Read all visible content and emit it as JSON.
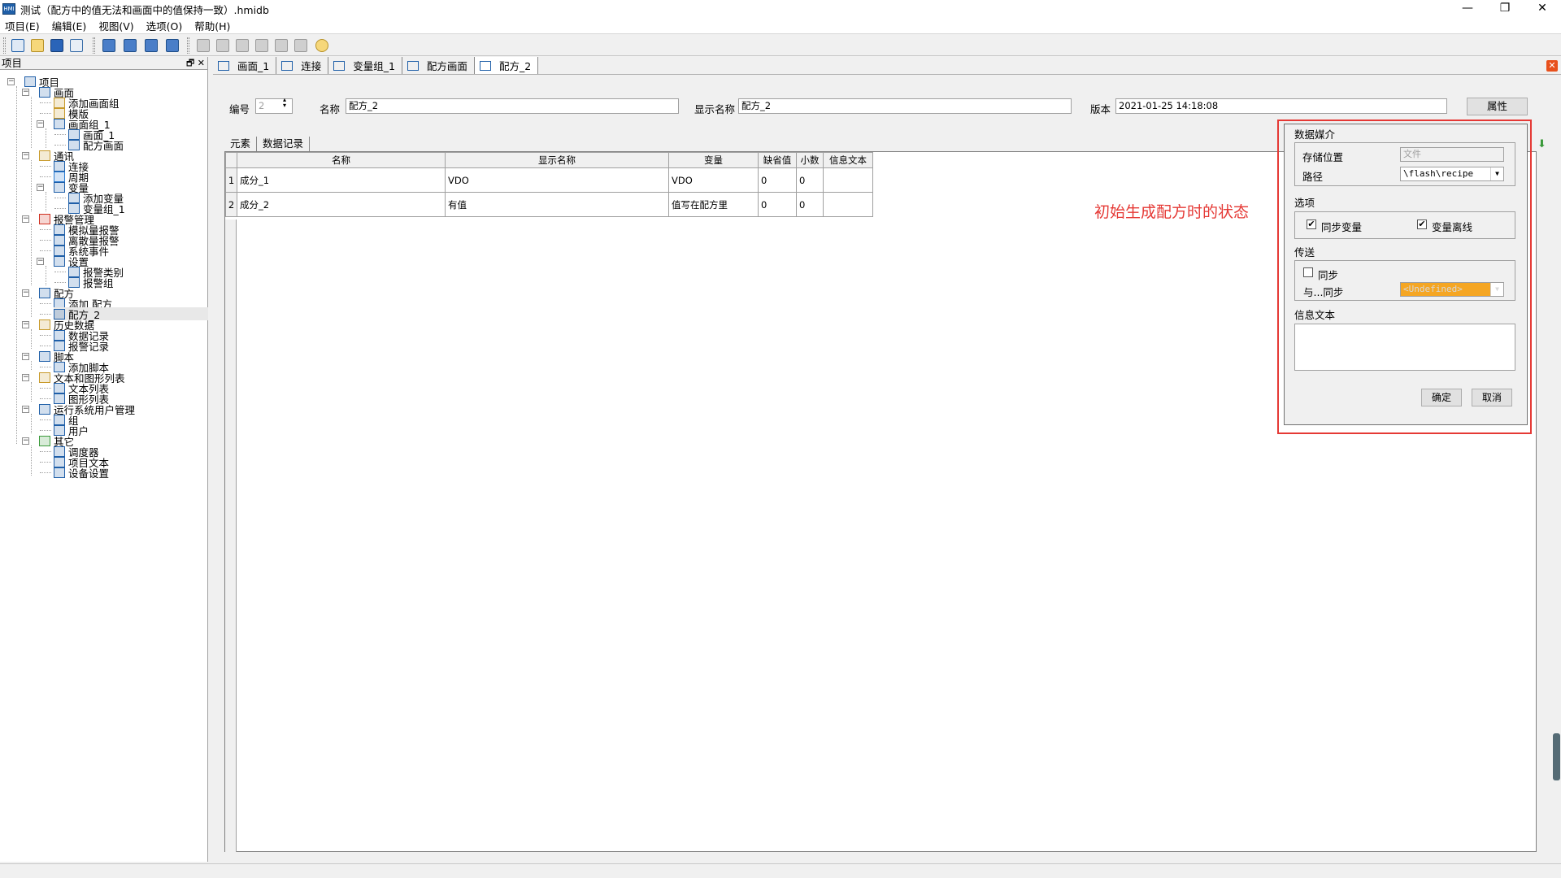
{
  "window": {
    "title": "测试（配方中的值无法和画面中的值保持一致）.hmidb",
    "app_icon_text": "HMI"
  },
  "menu": [
    "项目(E)",
    "编辑(E)",
    "视图(V)",
    "选项(O)",
    "帮助(H)"
  ],
  "left_panel": {
    "title": "项目",
    "tree": [
      {
        "label": "项目",
        "icon": "project-icon",
        "color": "#1f5fa8"
      },
      {
        "label": "画面",
        "icon": "screens-folder-icon",
        "color": "#1f5fa8"
      },
      {
        "label": "添加画面组",
        "icon": "add-screen-group-icon",
        "color": "#c89a2a"
      },
      {
        "label": "模版",
        "icon": "template-icon",
        "color": "#c89a2a"
      },
      {
        "label": "画面组_1",
        "icon": "screen-group-icon",
        "color": "#1f5fa8"
      },
      {
        "label": "画面_1",
        "icon": "screen-icon",
        "color": "#1f5fa8"
      },
      {
        "label": "配方画面",
        "icon": "screen-icon",
        "color": "#1f5fa8"
      },
      {
        "label": "通讯",
        "icon": "communication-icon",
        "color": "#c89a2a"
      },
      {
        "label": "连接",
        "icon": "connection-icon",
        "color": "#1f5fa8"
      },
      {
        "label": "周期",
        "icon": "cycle-icon",
        "color": "#2a7ad0"
      },
      {
        "label": "变量",
        "icon": "tags-icon",
        "color": "#1f5fa8"
      },
      {
        "label": "添加变量",
        "icon": "add-tag-icon",
        "color": "#1f5fa8"
      },
      {
        "label": "变量组_1",
        "icon": "tag-group-icon",
        "color": "#1f5fa8"
      },
      {
        "label": "报警管理",
        "icon": "alarm-management-icon",
        "color": "#d03020"
      },
      {
        "label": "模拟量报警",
        "icon": "analog-alarm-icon",
        "color": "#1f5fa8"
      },
      {
        "label": "离散量报警",
        "icon": "discrete-alarm-icon",
        "color": "#1f5fa8"
      },
      {
        "label": "系统事件",
        "icon": "system-event-icon",
        "color": "#1f5fa8"
      },
      {
        "label": "设置",
        "icon": "settings-icon",
        "color": "#1f5fa8"
      },
      {
        "label": "报警类别",
        "icon": "alarm-class-icon",
        "color": "#1f5fa8"
      },
      {
        "label": "报警组",
        "icon": "alarm-group-icon",
        "color": "#1f5fa8"
      },
      {
        "label": "配方",
        "icon": "recipe-folder-icon",
        "color": "#1f5fa8"
      },
      {
        "label": "添加 配方",
        "icon": "add-recipe-icon",
        "color": "#1f5fa8"
      },
      {
        "label": "配方_2",
        "icon": "recipe-icon",
        "color": "#1f5fa8"
      },
      {
        "label": "历史数据",
        "icon": "history-data-icon",
        "color": "#c89a2a"
      },
      {
        "label": "数据记录",
        "icon": "data-log-icon",
        "color": "#1f5fa8"
      },
      {
        "label": "报警记录",
        "icon": "alarm-log-icon",
        "color": "#1f5fa8"
      },
      {
        "label": "脚本",
        "icon": "scripts-icon",
        "color": "#1f5fa8"
      },
      {
        "label": "添加脚本",
        "icon": "add-script-icon",
        "color": "#1f5fa8"
      },
      {
        "label": "文本和图形列表",
        "icon": "text-graphic-lists-icon",
        "color": "#c89a2a"
      },
      {
        "label": "文本列表",
        "icon": "text-list-icon",
        "color": "#1f5fa8"
      },
      {
        "label": "图形列表",
        "icon": "graphic-list-icon",
        "color": "#1f5fa8"
      },
      {
        "label": "运行系统用户管理",
        "icon": "user-management-icon",
        "color": "#1f5fa8"
      },
      {
        "label": "组",
        "icon": "group-icon",
        "color": "#1f5fa8"
      },
      {
        "label": "用户",
        "icon": "user-icon",
        "color": "#1f5fa8"
      },
      {
        "label": "其它",
        "icon": "other-icon",
        "color": "#3a9a3a"
      },
      {
        "label": "调度器",
        "icon": "scheduler-icon",
        "color": "#1f5fa8"
      },
      {
        "label": "项目文本",
        "icon": "project-text-icon",
        "color": "#1f5fa8"
      },
      {
        "label": "设备设置",
        "icon": "device-settings-icon",
        "color": "#1f5fa8"
      }
    ]
  },
  "doc_tabs": [
    "画面_1",
    "连接",
    "变量组_1",
    "配方画面",
    "配方_2"
  ],
  "recipe_header": {
    "number_label": "编号",
    "number_value": "2",
    "name_label": "名称",
    "name_value": "配方_2",
    "display_name_label": "显示名称",
    "display_name_value": "配方_2",
    "version_label": "版本",
    "version_value": "2021-01-25 14:18:08",
    "properties_button": "属性"
  },
  "inner_tabs": [
    "元素",
    "数据记录"
  ],
  "grid": {
    "columns": [
      "名称",
      "显示名称",
      "变量",
      "缺省值",
      "小数",
      "信息文本"
    ],
    "rows": [
      {
        "num": "1",
        "cells": [
          "成分_1",
          "VDO",
          "VDO",
          "0",
          "0",
          ""
        ]
      },
      {
        "num": "2",
        "cells": [
          "成分_2",
          "有值",
          "值写在配方里",
          "0",
          "0",
          ""
        ]
      }
    ]
  },
  "annotation": "初始生成配方时的状态",
  "dialog": {
    "data_medium_title": "数据媒介",
    "storage_label": "存储位置",
    "storage_value": "文件",
    "path_label": "路径",
    "path_value": "\\flash\\recipe",
    "options_title": "选项",
    "sync_tags_label": "同步变量",
    "sync_tags_checked": "✔",
    "tags_offline_label": "变量离线",
    "tags_offline_checked": "✔",
    "transfer_title": "传送",
    "sync_label": "同步",
    "sync_with_label": "与...同步",
    "sync_with_value": "<Undefined>",
    "sync_with_color": "#f5a623",
    "info_text_title": "信息文本",
    "ok_button": "确定",
    "cancel_button": "取消"
  }
}
